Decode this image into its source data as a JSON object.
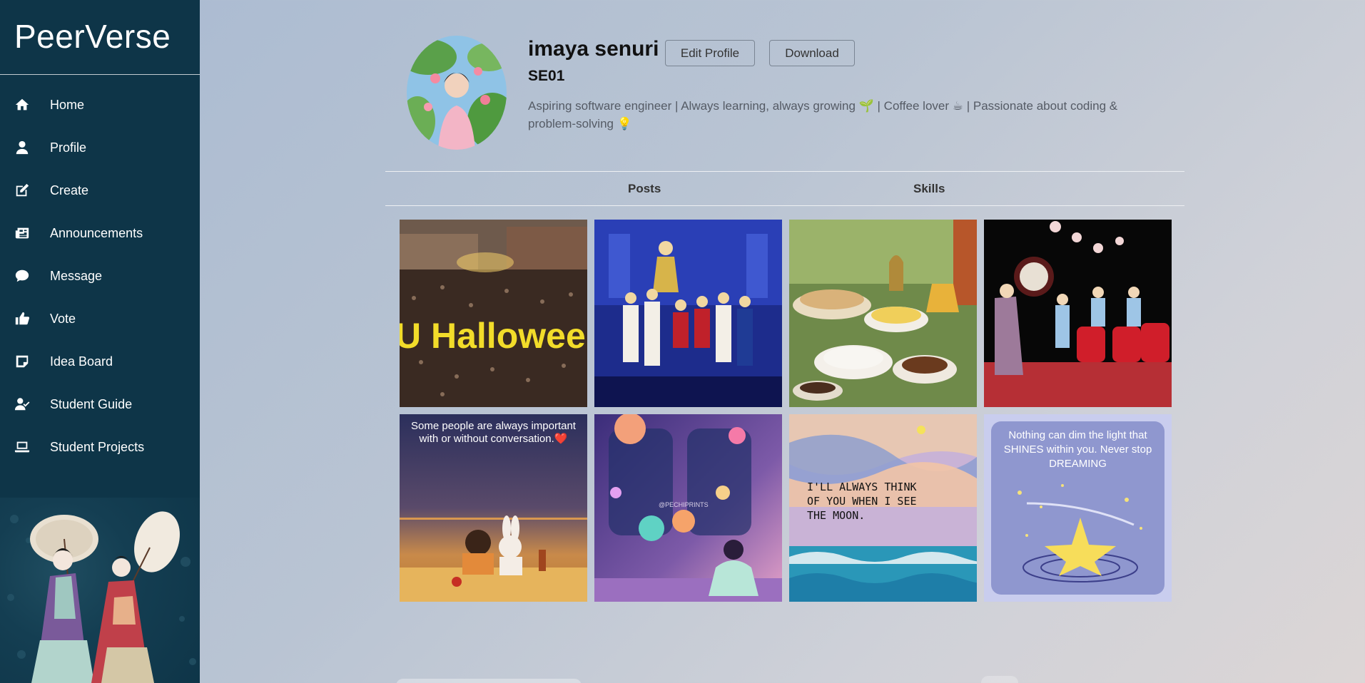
{
  "app": {
    "brand": "PeerVerse"
  },
  "sidebar": {
    "items": [
      {
        "label": "Home",
        "icon": "home-icon"
      },
      {
        "label": "Profile",
        "icon": "user-icon"
      },
      {
        "label": "Create",
        "icon": "edit-icon"
      },
      {
        "label": "Announcements",
        "icon": "newspaper-icon"
      },
      {
        "label": "Message",
        "icon": "chat-bubble-icon"
      },
      {
        "label": "Vote",
        "icon": "thumbs-up-icon"
      },
      {
        "label": "Idea Board",
        "icon": "note-icon"
      },
      {
        "label": "Student Guide",
        "icon": "user-check-icon"
      },
      {
        "label": "Student Projects",
        "icon": "laptop-icon"
      }
    ]
  },
  "profile": {
    "name": "imaya senuri",
    "handle": "SE01",
    "bio": "Aspiring software engineer | Always learning, always growing 🌱 | Coffee lover ☕ | Passionate about coding & problem-solving 💡",
    "edit_label": "Edit Profile",
    "download_label": "Download"
  },
  "tabs": [
    {
      "label": "Posts"
    },
    {
      "label": "Skills"
    }
  ],
  "posts": [
    {
      "kind": "halloween-crowd",
      "caption": "U Hallowee"
    },
    {
      "kind": "stage-performance",
      "caption": ""
    },
    {
      "kind": "food-table",
      "caption": ""
    },
    {
      "kind": "drum-festival",
      "caption": ""
    },
    {
      "kind": "friends-sunset",
      "caption": "Some people are always important with or without conversation.❤️"
    },
    {
      "kind": "space-train",
      "caption": "@PECHIPRINTS"
    },
    {
      "kind": "moon-sea-painting",
      "caption": "I'LL ALWAYS THINK OF YOU WHEN I SEE THE MOON."
    },
    {
      "kind": "dream-star",
      "caption": "Nothing can dim the light that SHINES within you. Never stop DREAMING"
    }
  ],
  "colors": {
    "sidebar_bg": "#0e3548",
    "text_dark": "#111111",
    "bio_text": "#555b65",
    "button_border": "#7a8593"
  }
}
